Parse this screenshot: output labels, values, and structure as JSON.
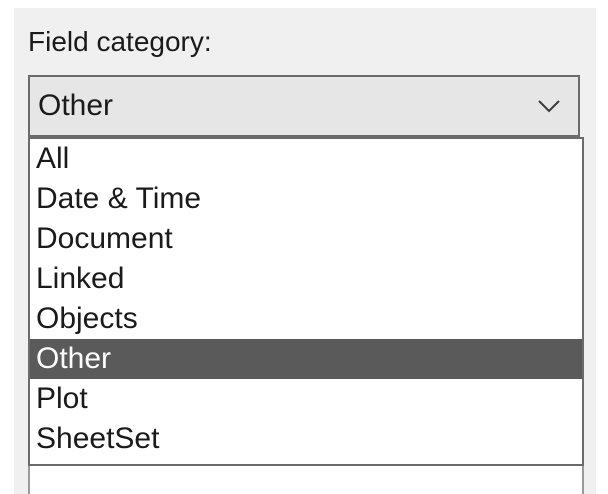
{
  "field_category": {
    "label": "Field category:",
    "selected_value": "Other",
    "arrow_icon": "chevron-down-icon",
    "options": [
      "All",
      "Date & Time",
      "Document",
      "Linked",
      "Objects",
      "Other",
      "Plot",
      "SheetSet"
    ],
    "highlighted_option": "Other"
  },
  "colors": {
    "panel_background": "#f0f0f0",
    "combo_background": "#e6e6e6",
    "border": "#6b6b6b",
    "selection_background": "#5a5a5a",
    "selection_text": "#ffffff",
    "text": "#1a1a1a"
  }
}
